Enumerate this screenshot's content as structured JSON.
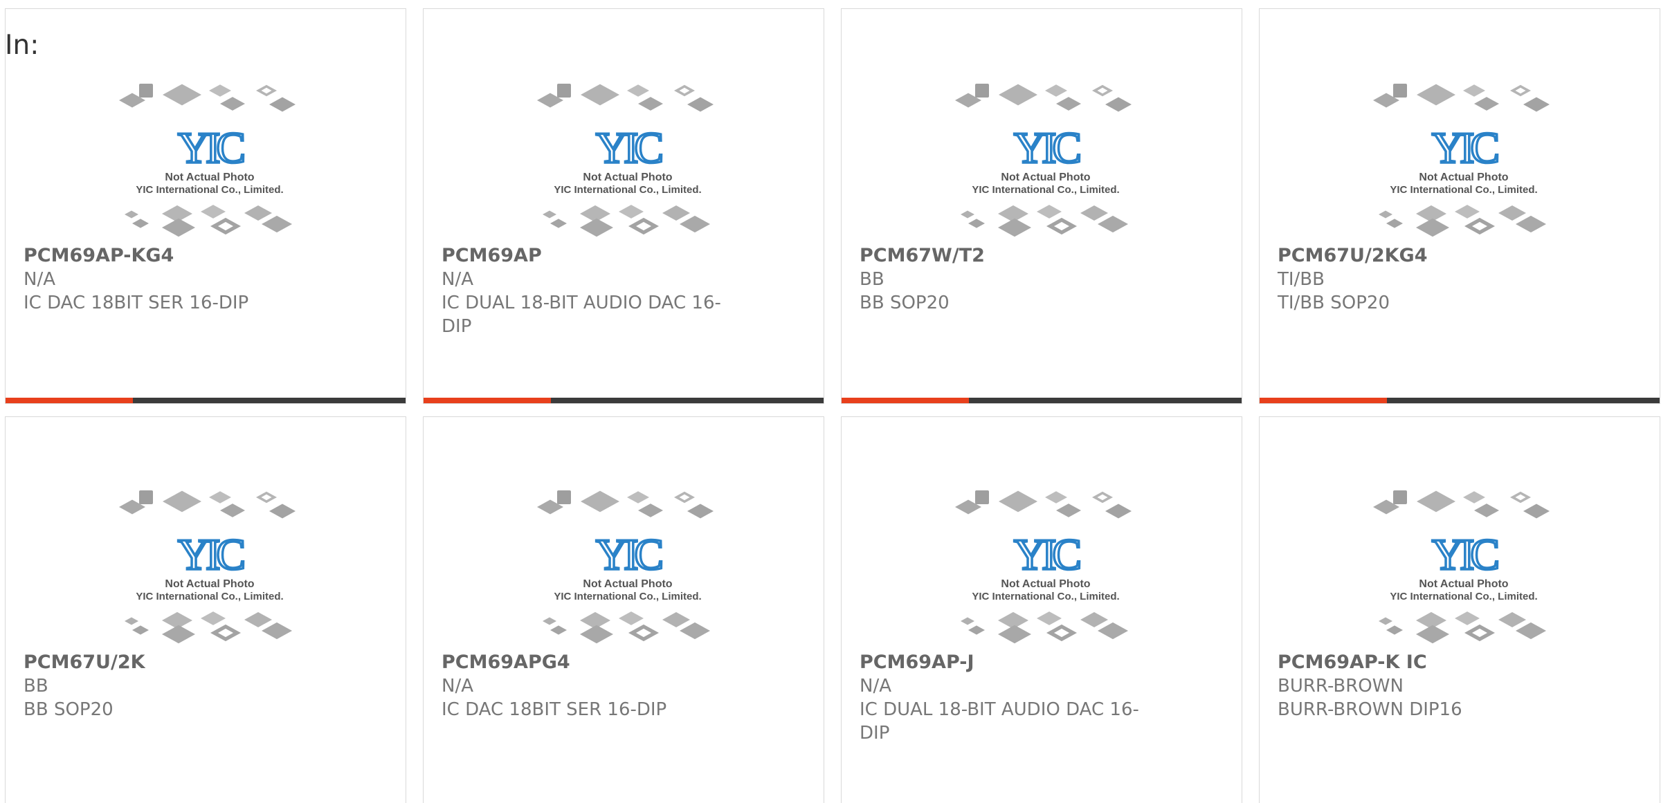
{
  "header": {
    "label": "In:"
  },
  "colors": {
    "accent": "#e8401c",
    "bar": "#3b3b3b",
    "logo_blue": "#2a82c8"
  },
  "placeholder": {
    "line1": "Not Actual Photo",
    "line2": "YIC International Co., Limited.",
    "logo": "YIC"
  },
  "products": [
    {
      "part": "PCM69AP-KG4",
      "mfr": "N/A",
      "desc": "IC DAC 18BIT SER 16-DIP",
      "show_bar": true
    },
    {
      "part": "PCM69AP",
      "mfr": "N/A",
      "desc": "IC DUAL 18-BIT AUDIO DAC 16-DIP",
      "show_bar": true
    },
    {
      "part": "PCM67W/T2",
      "mfr": "BB",
      "desc": "BB SOP20",
      "show_bar": true
    },
    {
      "part": "PCM67U/2KG4",
      "mfr": "TI/BB",
      "desc": "TI/BB SOP20",
      "show_bar": true
    },
    {
      "part": "PCM67U/2K",
      "mfr": "BB",
      "desc": "BB SOP20",
      "show_bar": false
    },
    {
      "part": "PCM69APG4",
      "mfr": "N/A",
      "desc": "IC DAC 18BIT SER 16-DIP",
      "show_bar": false
    },
    {
      "part": "PCM69AP-J",
      "mfr": "N/A",
      "desc": "IC DUAL 18-BIT AUDIO DAC 16-DIP",
      "show_bar": false
    },
    {
      "part": "PCM69AP-K IC",
      "mfr": "BURR-BROWN",
      "desc": "BURR-BROWN DIP16",
      "show_bar": false
    }
  ]
}
